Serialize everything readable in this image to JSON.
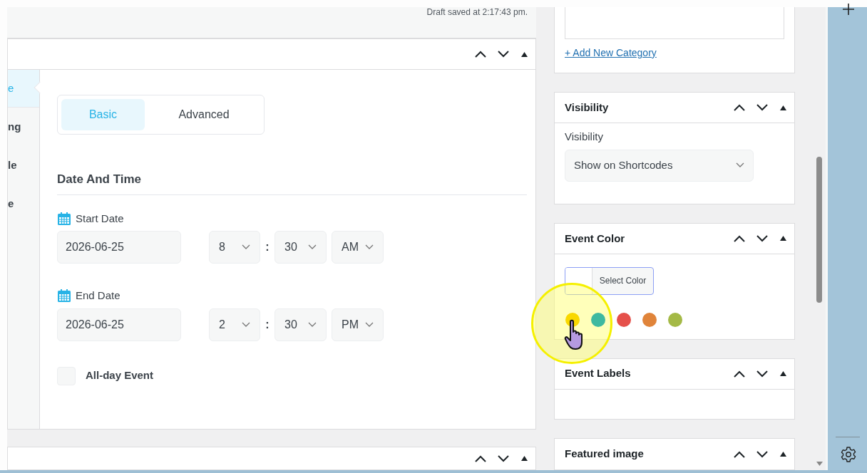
{
  "status": {
    "draft_saved": "Draft saved at 2:17:43 pm."
  },
  "main_panel": {
    "side_tabs": [
      {
        "label": "e",
        "selected": true
      },
      {
        "label": "ng",
        "selected": false
      },
      {
        "label": "le",
        "selected": false
      },
      {
        "label": "e",
        "selected": false
      }
    ],
    "sub_tabs": [
      {
        "label": "Basic",
        "selected": true
      },
      {
        "label": "Advanced",
        "selected": false
      }
    ],
    "section_title": "Date And Time",
    "dates": [
      {
        "label": "Start Date",
        "date": "2026-06-25",
        "hour": "8",
        "separator": ":",
        "minute": "30",
        "period": "AM"
      },
      {
        "label": "End Date",
        "date": "2026-06-25",
        "hour": "2",
        "separator": ":",
        "minute": "30",
        "period": "PM"
      }
    ],
    "all_day": {
      "label": "All-day Event",
      "checked": false
    }
  },
  "sidebar": {
    "category": {
      "add_link": "+ Add New Category"
    },
    "visibility": {
      "title": "Visibility",
      "label": "Visibility",
      "value": "Show on Shortcodes"
    },
    "event_color": {
      "title": "Event Color",
      "button": "Select Color",
      "swatches": [
        {
          "color": "#f9d800"
        },
        {
          "color": "#3fb9a0"
        },
        {
          "color": "#e5504a"
        },
        {
          "color": "#e0843a"
        },
        {
          "color": "#a4b946"
        }
      ]
    },
    "event_labels": {
      "title": "Event Labels"
    },
    "featured_image": {
      "title": "Featured image"
    }
  }
}
